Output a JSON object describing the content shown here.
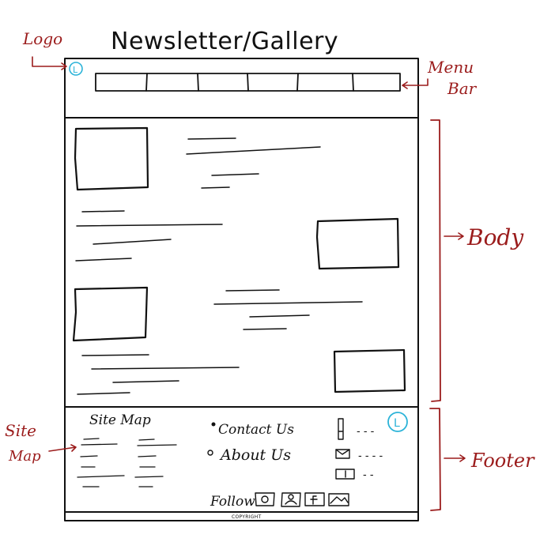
{
  "title": "Newsletter/Gallery",
  "annotations": {
    "logo": "Logo",
    "menu_bar_line1": "Menu",
    "menu_bar_line2": "Bar",
    "body": "Body",
    "footer": "Footer",
    "site_map_line1": "Site",
    "site_map_line2": "Map"
  },
  "logo_letter": "L",
  "footer": {
    "site_map_heading": "Site Map",
    "contact_us": "Contact Us",
    "about_us": "About Us",
    "phone_dashes": "- - -",
    "mail_dashes": "- - - -",
    "address_dashes": "- -",
    "follow_label": "Follow",
    "copyright": "COPYRIGHT",
    "social_icons": [
      "camera-icon",
      "people-icon",
      "facebook-icon",
      "photo-icon"
    ]
  },
  "colors": {
    "ink": "#111111",
    "annotation": "#9b1c1c",
    "logo": "#2bb3d8"
  }
}
